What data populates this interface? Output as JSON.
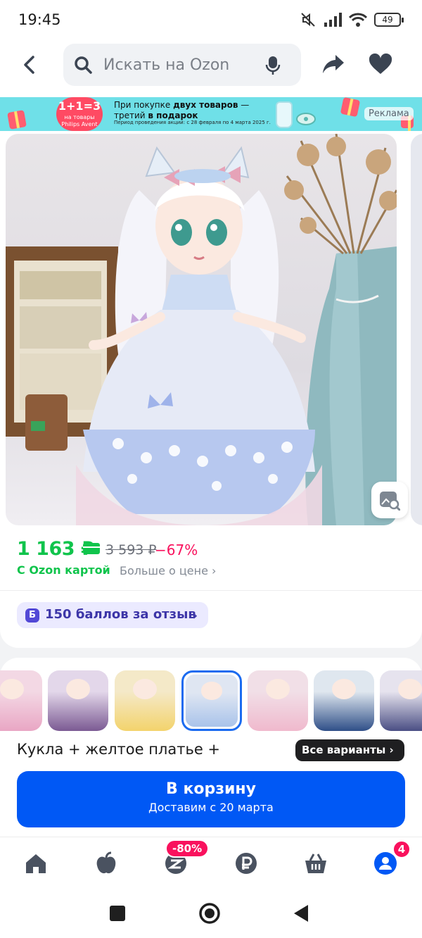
{
  "status_bar": {
    "time": "19:45",
    "battery": "49"
  },
  "header": {
    "search_placeholder": "Искать на Ozon"
  },
  "promo_banner": {
    "badge_main": "1+1=3",
    "badge_sub": "на товары Philips Avent",
    "text_line1_prefix": "При покупке ",
    "text_line1_bold": "двух товаров",
    "text_line1_suffix": " —",
    "text_line2_prefix": "третий ",
    "text_line2_bold": "в подарок",
    "period": "Период проведения акции: с 28 февраля по 4 марта 2025 г.",
    "ad_label": "Реклама"
  },
  "price": {
    "current": "1 163 ₽",
    "old": "3 593 ₽",
    "discount": "−67%",
    "card_label": "С Ozon картой",
    "more_label": "Больше о цене ›"
  },
  "points": {
    "icon_letter": "Б",
    "label": "150 баллов за отзыв",
    "chevron": "›"
  },
  "variants": {
    "selected_name": "Кукла + желтое платье +",
    "all_button": "Все варианты ›",
    "thumbnails": [
      {
        "colors": [
          "#f3d8e4",
          "#e9a6c4"
        ],
        "selected": false
      },
      {
        "colors": [
          "#e3d7ea",
          "#7b5a93"
        ],
        "selected": false
      },
      {
        "colors": [
          "#f4e9c8",
          "#f3d36c"
        ],
        "selected": false
      },
      {
        "colors": [
          "#dfe6f2",
          "#a9c3ea"
        ],
        "selected": true
      },
      {
        "colors": [
          "#f1dfe7",
          "#f0b9cd"
        ],
        "selected": false
      },
      {
        "colors": [
          "#dfe7ef",
          "#2f4f88"
        ],
        "selected": false
      },
      {
        "colors": [
          "#e6e3ee",
          "#4a4e84"
        ],
        "selected": false
      }
    ]
  },
  "cart_button": {
    "title": "В корзину",
    "subtitle": "Доставим с 20 марта"
  },
  "bottom_nav": {
    "sale_badge": "-80%",
    "profile_badge": "4"
  },
  "colors": {
    "price_green": "#10c44c",
    "accent_blue": "#0058f5",
    "sale_pink": "#f9115d"
  }
}
